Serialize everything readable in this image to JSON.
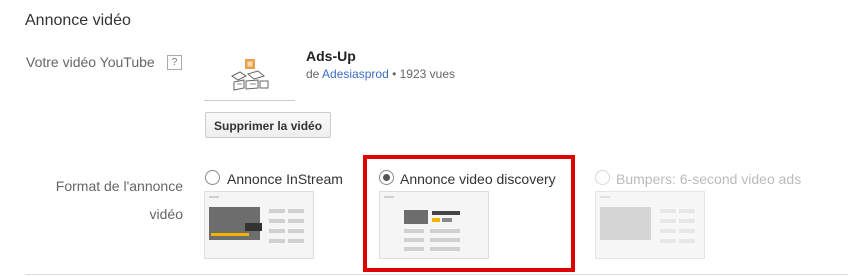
{
  "section": {
    "title": "Annonce vidéo"
  },
  "video_field": {
    "label": "Votre vidéo YouTube",
    "help_icon": "?",
    "title": "Ads-Up",
    "by_prefix": "de ",
    "channel": "Adesiasprod",
    "separator": " • ",
    "views": "1923 vues",
    "remove_button": "Supprimer la vidéo"
  },
  "format_field": {
    "label_line1": "Format de l'annonce",
    "label_line2": "vidéo",
    "options": [
      {
        "label": "Annonce InStream",
        "selected": false,
        "disabled": false
      },
      {
        "label": "Annonce video discovery",
        "selected": true,
        "disabled": false
      },
      {
        "label": "Bumpers: 6-second video ads",
        "selected": false,
        "disabled": true
      }
    ]
  },
  "colors": {
    "highlight": "#e00000",
    "link": "#3b6ec3",
    "accent_yellow": "#f2b400"
  }
}
